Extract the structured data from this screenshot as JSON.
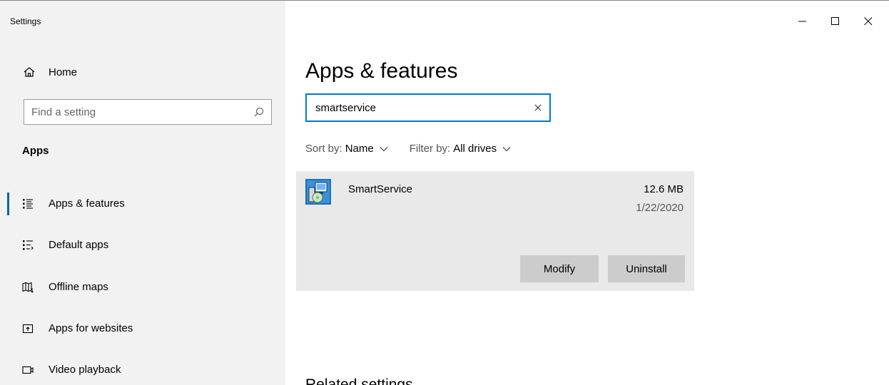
{
  "window": {
    "title": "Settings"
  },
  "sidebar": {
    "home_label": "Home",
    "search_placeholder": "Find a setting",
    "section_heading": "Apps",
    "items": [
      {
        "label": "Apps & features",
        "icon": "apps-features-icon",
        "active": true
      },
      {
        "label": "Default apps",
        "icon": "default-apps-icon",
        "active": false
      },
      {
        "label": "Offline maps",
        "icon": "offline-maps-icon",
        "active": false
      },
      {
        "label": "Apps for websites",
        "icon": "apps-for-websites-icon",
        "active": false
      },
      {
        "label": "Video playback",
        "icon": "video-playback-icon",
        "active": false
      }
    ]
  },
  "main": {
    "title": "Apps & features",
    "search_value": "smartservice",
    "sort_key": "Sort by:",
    "sort_value": "Name",
    "filter_key": "Filter by:",
    "filter_value": "All drives",
    "app": {
      "name": "SmartService",
      "size": "12.6 MB",
      "date": "1/22/2020",
      "modify_label": "Modify",
      "uninstall_label": "Uninstall"
    },
    "related_heading": "Related settings"
  },
  "colors": {
    "accent": "#0078d7",
    "active_indicator": "#0063b1",
    "sidebar_bg": "#f2f2f2",
    "card_bg": "#e9e9e9",
    "button_bg": "#cccccc"
  }
}
